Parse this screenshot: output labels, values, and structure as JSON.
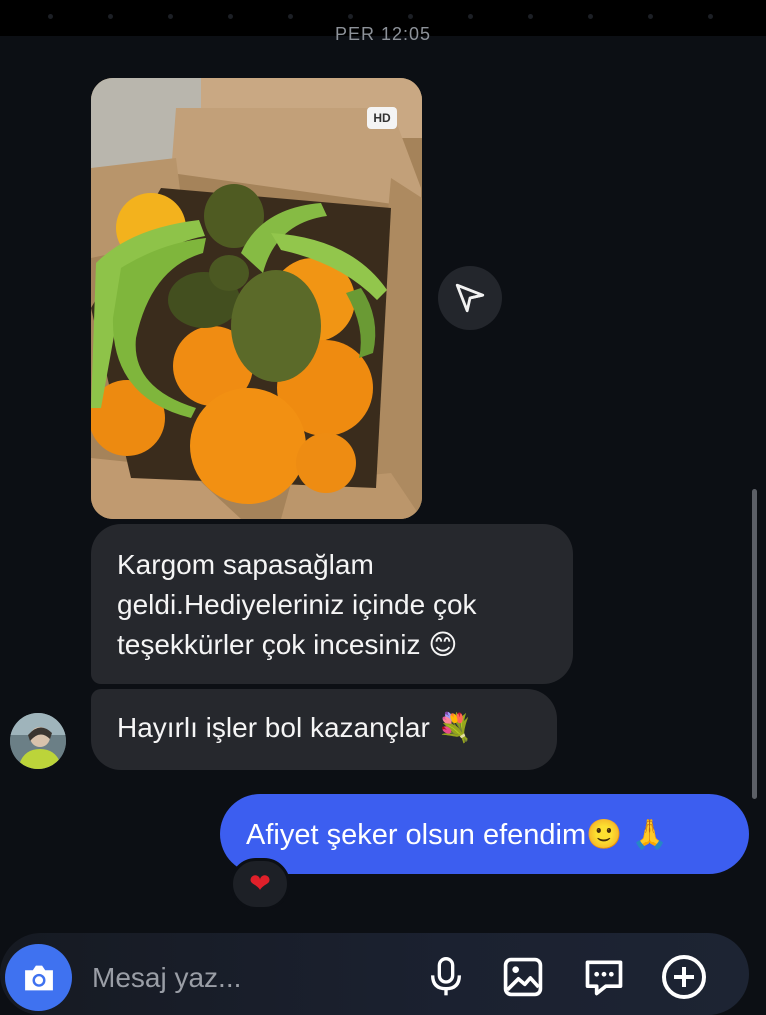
{
  "header": {
    "timestamp": "PER 12:05"
  },
  "thread": {
    "photo_message": {
      "hd_badge": "HD"
    },
    "incoming": [
      {
        "text": "Kargom sapasağlam geldi.Hediyeleriniz içinde çok teşekkürler çok incesiniz",
        "emoji": "😊"
      },
      {
        "text": "Hayırlı işler bol kazançlar",
        "emoji": "💐"
      }
    ],
    "outgoing": [
      {
        "text": "Afiyet şeker olsun efendim",
        "emoji": "🙂 🙏",
        "reaction": "❤"
      }
    ]
  },
  "composer": {
    "placeholder": "Mesaj yaz..."
  },
  "colors": {
    "background": "#0c0f14",
    "incoming_bubble": "#26282d",
    "outgoing_bubble": "#3c5ef0",
    "camera_button": "#3f72f0",
    "reaction_heart": "#e0202a"
  },
  "icons": {
    "share": "paper-plane-icon",
    "camera": "camera-icon",
    "microphone": "microphone-icon",
    "gallery": "image-icon",
    "chat": "chat-bubble-icon",
    "add": "plus-circle-icon"
  }
}
